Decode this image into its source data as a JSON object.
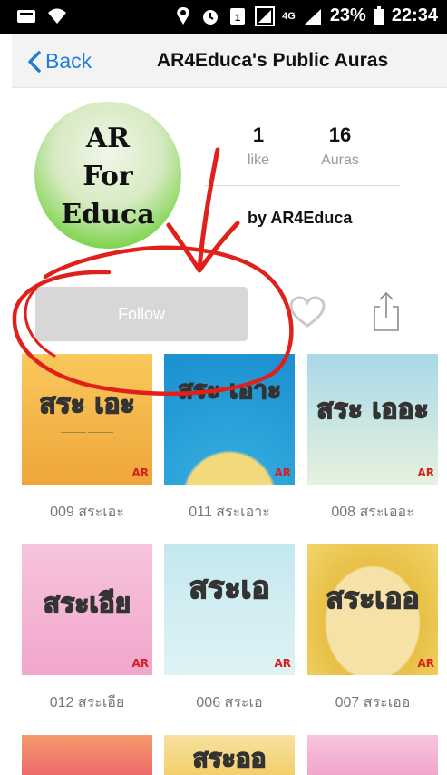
{
  "status_bar": {
    "battery_percent": "23%",
    "time": "22:34",
    "network": "4G"
  },
  "nav": {
    "back_label": "Back",
    "title": "AR4Educa's Public Auras"
  },
  "profile": {
    "avatar_lines": [
      "AR",
      "For",
      "Educa"
    ],
    "likes_count": "1",
    "likes_label": "like",
    "auras_count": "16",
    "auras_label": "Auras",
    "owner": "by AR4Educa",
    "follow_label": "Follow"
  },
  "auras": [
    {
      "label": "009 สระเอะ",
      "art_text": "สระ เอะ",
      "bg": "#f4b64a"
    },
    {
      "label": "011 สระเอาะ",
      "art_text": "สระ เอาะ",
      "bg": "#35a5d8"
    },
    {
      "label": "008 สระเออะ",
      "art_text": "สระ เออะ",
      "bg": "#cfe9d8"
    },
    {
      "label": "012 สระเอีย",
      "art_text": "สระเอีย",
      "bg": "#f4b8d8"
    },
    {
      "label": "006 สระเอ",
      "art_text": "สระเอ",
      "bg": "#cdeaf0"
    },
    {
      "label": "007 สระเออ",
      "art_text": "สระเออ",
      "bg": "#f5e28a"
    },
    {
      "label": "",
      "art_text": "",
      "bg": "#f06a6a"
    },
    {
      "label": "",
      "art_text": "สระออ",
      "bg": "#f5d98a"
    },
    {
      "label": "",
      "art_text": "",
      "bg": "#f4b8d8"
    }
  ],
  "colors": {
    "accent": "#1d7ed8",
    "follow_bg": "#d7d7d7",
    "annotation": "#e0201a"
  }
}
